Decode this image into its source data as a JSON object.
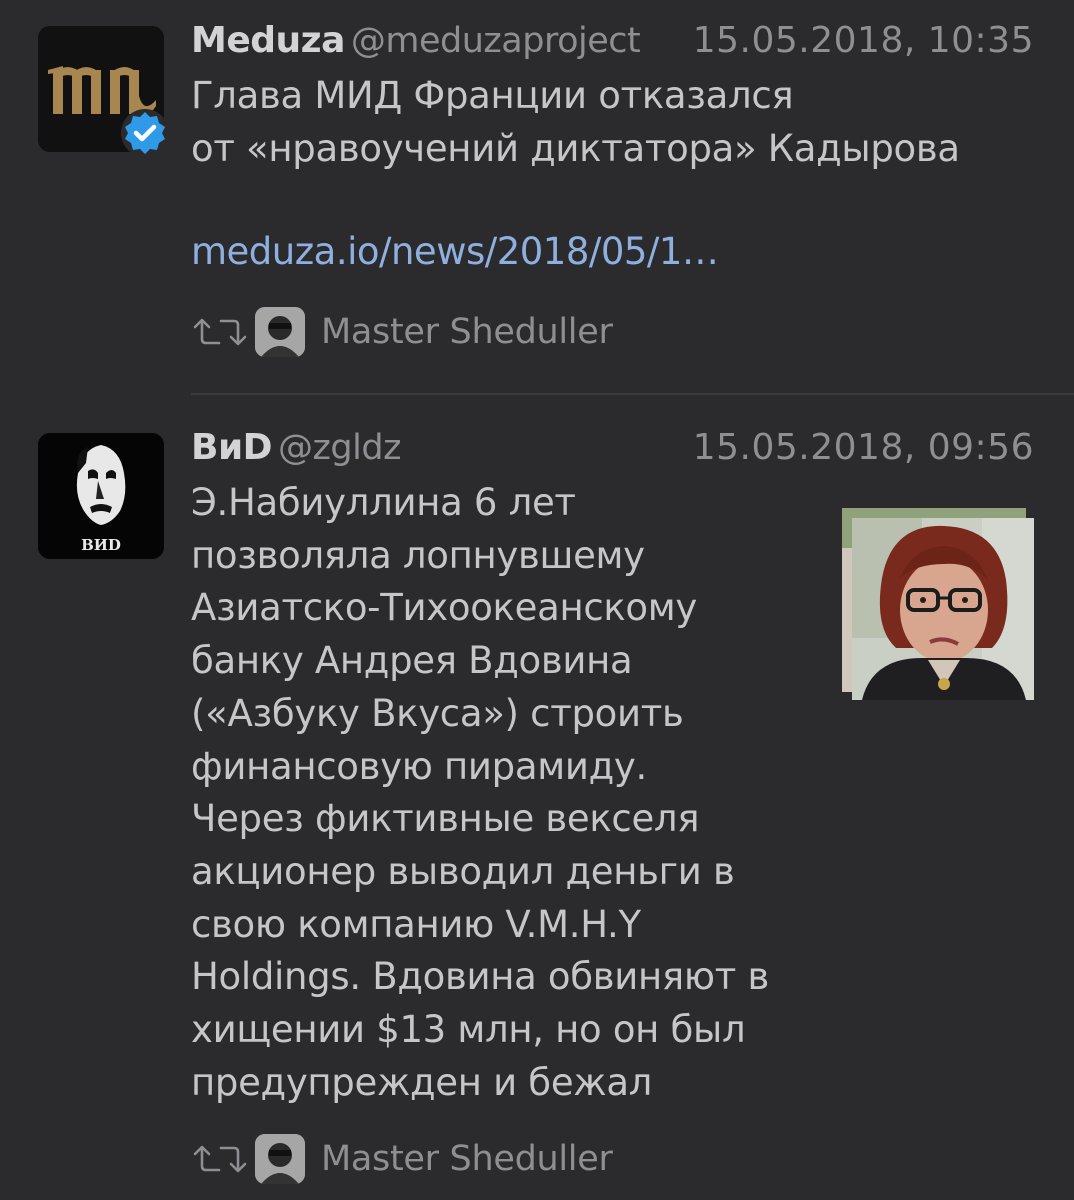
{
  "tweets": [
    {
      "author_name": "Meduza",
      "handle": "@meduzaproject",
      "timestamp": "15.05.2018, 10:35",
      "text": "Глава МИД Франции отказался\nот «нравоучений диктатора» Кадырова",
      "link": "meduza.io/news/2018/05/1…",
      "verified": true,
      "avatar_icon": "meduza-logo-icon",
      "retweeted_by": "Master Sheduller"
    },
    {
      "author_name": "ВиD",
      "handle": "@zgldz",
      "timestamp": "15.05.2018, 09:56",
      "text": "Э.Набиуллина 6 лет\nпозволяла лопнувшему\nАзиатско-Тихоокеанскому\nбанку Андрея Вдовина\n(«Азбуку Вкуса») строить\nфинансовую пирамиду.\nЧерез фиктивные векселя\nакционер выводил деньги в\nсвою компанию V.M.H.Y\nHoldings. Вдовина обвиняют в\nхищении $13 млн, но он был\nпредупрежден и бежал",
      "avatar_label": "ВИD",
      "retweeted_by": "Master Sheduller"
    }
  ],
  "colors": {
    "background": "#2b2b2d",
    "text": "#c6c6c8",
    "muted": "#8e8e93",
    "link": "#8fb0df",
    "verified": "#2f9ae8",
    "meduza_gold": "#a8864f"
  }
}
